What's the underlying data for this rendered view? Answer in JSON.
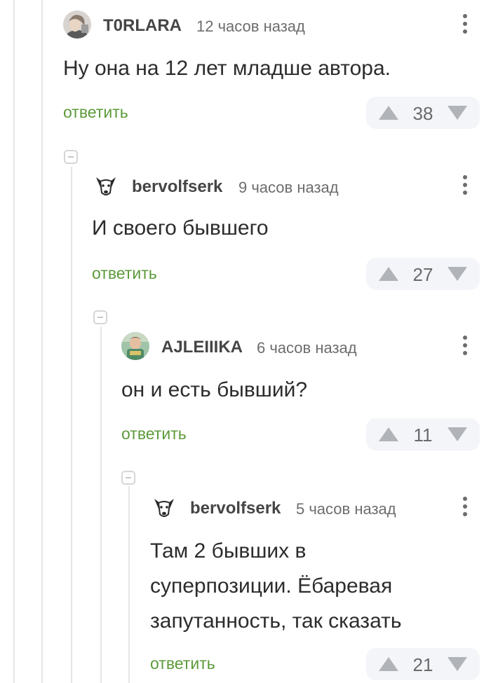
{
  "comments": [
    {
      "author": "T0RLARA",
      "time": "12 часов назад",
      "text": [
        "Ну она на 12 лет младше автора."
      ],
      "reply_label": "ответить",
      "rating": "38"
    },
    {
      "author": "bervolfserk",
      "time": "9 часов назад",
      "text": [
        "И своего бывшего"
      ],
      "reply_label": "ответить",
      "rating": "27"
    },
    {
      "author": "AJLEIIIKA",
      "time": "6 часов назад",
      "text": [
        "он и есть бывший?"
      ],
      "reply_label": "ответить",
      "rating": "11"
    },
    {
      "author": "bervolfserk",
      "time": "5 часов назад",
      "text": [
        "Там 2 бывших в",
        "суперпозиции. Ёбаревая",
        "запутанность, так сказать"
      ],
      "reply_label": "ответить",
      "rating": "21"
    }
  ],
  "colors": {
    "reply_link": "#5d9a3b",
    "rating_bg": "#f3f5f8",
    "arrow": "#b0b3b8",
    "thread_line": "#e6e6e6"
  },
  "icons": {
    "more": "vertical-dots-icon",
    "upvote": "arrow-up-icon",
    "downvote": "arrow-down-icon",
    "collapse": "collapse-minus-icon"
  }
}
